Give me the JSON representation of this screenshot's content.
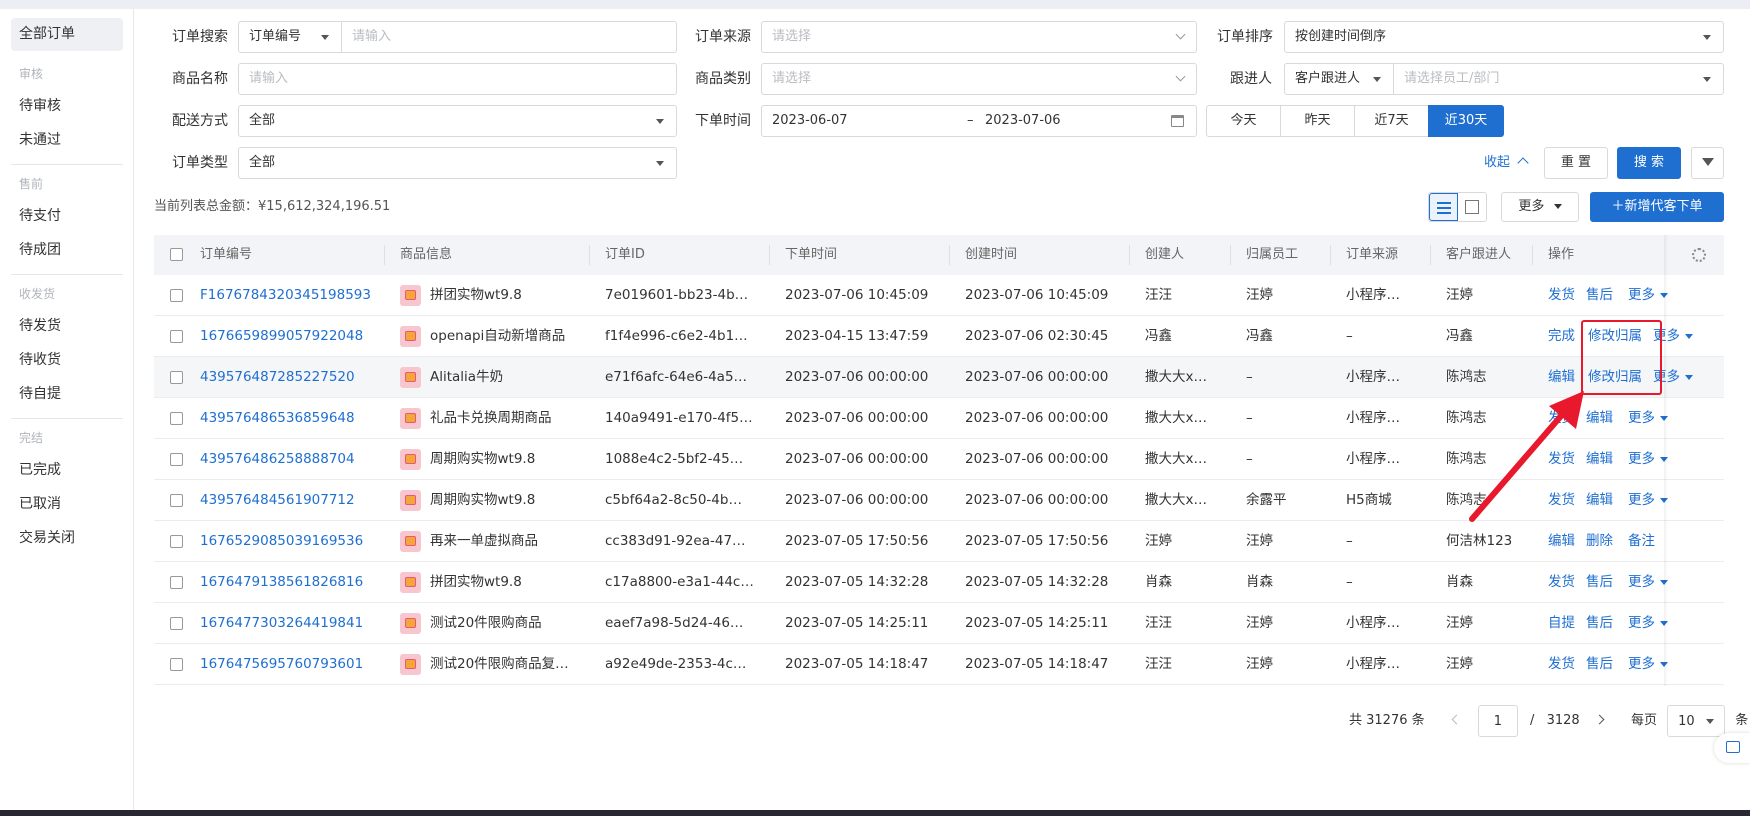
{
  "sidebar": {
    "active": "全部订单",
    "groups": [
      {
        "title": "审核",
        "items": [
          "待审核",
          "未通过"
        ]
      },
      {
        "title": "售前",
        "items": [
          "待支付",
          "待成团"
        ]
      },
      {
        "title": "收发货",
        "items": [
          "待发货",
          "待收货",
          "待自提"
        ]
      },
      {
        "title": "完结",
        "items": [
          "已完成",
          "已取消",
          "交易关闭"
        ]
      }
    ]
  },
  "filters": {
    "order_search_label": "订单搜索",
    "order_search_type": "订单编号",
    "order_search_placeholder": "请输入",
    "order_source_label": "订单来源",
    "order_source_placeholder": "请选择",
    "order_sort_label": "订单排序",
    "order_sort_value": "按创建时间倒序",
    "product_name_label": "商品名称",
    "product_name_placeholder": "请输入",
    "product_category_label": "商品类别",
    "product_category_placeholder": "请选择",
    "follower_label": "跟进人",
    "follower_type": "客户跟进人",
    "follower_placeholder": "请选择员工/部门",
    "delivery_label": "配送方式",
    "delivery_value": "全部",
    "order_time_label": "下单时间",
    "date_start": "2023-06-07",
    "date_sep": "–",
    "date_end": "2023-07-06",
    "quick_ranges": [
      "今天",
      "昨天",
      "近7天",
      "近30天"
    ],
    "order_type_label": "订单类型",
    "order_type_value": "全部",
    "collapse": "收起",
    "reset": "重 置",
    "search": "搜 索"
  },
  "summary": "当前列表总金额：¥15,612,324,196.51",
  "toolbar": {
    "more": "更多",
    "add_order": "新增代客下单"
  },
  "table": {
    "headers": [
      "订单编号",
      "商品信息",
      "订单ID",
      "下单时间",
      "创建时间",
      "创建人",
      "归属员工",
      "订单来源",
      "客户跟进人",
      "操作"
    ],
    "rows": [
      {
        "no": "F1676784320345198593",
        "product": "拼团实物wt9.8",
        "id": "7e019601-bb23-4b…",
        "order_time": "2023-07-06 10:45:09",
        "create_time": "2023-07-06 10:45:09",
        "creator": "汪汪",
        "staff": "汪婷",
        "source": "小程序…",
        "follower": "汪婷",
        "ops": [
          "发货",
          "售后",
          "更多"
        ]
      },
      {
        "no": "1676659899057922048",
        "product": "openapi自动新增商品",
        "id": "f1f4e996-c6e2-4b1…",
        "order_time": "2023-04-15 13:47:59",
        "create_time": "2023-07-06 02:30:45",
        "creator": "冯鑫",
        "staff": "冯鑫",
        "source": "–",
        "follower": "冯鑫",
        "ops": [
          "完成",
          "修改归属",
          "更多"
        ]
      },
      {
        "no": "439576487285227520",
        "product": "Alitalia牛奶",
        "id": "e71f6afc-64e6-4a5…",
        "order_time": "2023-07-06 00:00:00",
        "create_time": "2023-07-06 00:00:00",
        "creator": "撒大大x…",
        "staff": "–",
        "source": "小程序…",
        "follower": "陈鸿志",
        "ops": [
          "编辑",
          "修改归属",
          "更多"
        ]
      },
      {
        "no": "439576486536859648",
        "product": "礼品卡兑换周期商品",
        "id": "140a9491-e170-4f5…",
        "order_time": "2023-07-06 00:00:00",
        "create_time": "2023-07-06 00:00:00",
        "creator": "撒大大x…",
        "staff": "–",
        "source": "小程序…",
        "follower": "陈鸿志",
        "ops": [
          "发货",
          "编辑",
          "更多"
        ]
      },
      {
        "no": "439576486258888704",
        "product": "周期购实物wt9.8",
        "id": "1088e4c2-5bf2-45…",
        "order_time": "2023-07-06 00:00:00",
        "create_time": "2023-07-06 00:00:00",
        "creator": "撒大大x…",
        "staff": "–",
        "source": "小程序…",
        "follower": "陈鸿志",
        "ops": [
          "发货",
          "编辑",
          "更多"
        ]
      },
      {
        "no": "439576484561907712",
        "product": "周期购实物wt9.8",
        "id": "c5bf64a2-8c50-4b…",
        "order_time": "2023-07-06 00:00:00",
        "create_time": "2023-07-06 00:00:00",
        "creator": "撒大大x…",
        "staff": "余露平",
        "source": "H5商城",
        "follower": "陈鸿志",
        "ops": [
          "发货",
          "编辑",
          "更多"
        ]
      },
      {
        "no": "1676529085039169536",
        "product": "再来一单虚拟商品",
        "id": "cc383d91-92ea-47…",
        "order_time": "2023-07-05 17:50:56",
        "create_time": "2023-07-05 17:50:56",
        "creator": "汪婷",
        "staff": "汪婷",
        "source": "–",
        "follower": "何洁林123",
        "ops": [
          "编辑",
          "删除",
          "备注"
        ]
      },
      {
        "no": "1676479138561826816",
        "product": "拼团实物wt9.8",
        "id": "c17a8800-e3a1-44c…",
        "order_time": "2023-07-05 14:32:28",
        "create_time": "2023-07-05 14:32:28",
        "creator": "肖森",
        "staff": "肖森",
        "source": "–",
        "follower": "肖森",
        "ops": [
          "发货",
          "售后",
          "更多"
        ]
      },
      {
        "no": "1676477303264419841",
        "product": "测试20件限购商品",
        "id": "eaef7a98-5d24-46…",
        "order_time": "2023-07-05 14:25:11",
        "create_time": "2023-07-05 14:25:11",
        "creator": "汪汪",
        "staff": "汪婷",
        "source": "小程序…",
        "follower": "汪婷",
        "ops": [
          "自提",
          "售后",
          "更多"
        ]
      },
      {
        "no": "1676475695760793601",
        "product": "测试20件限购商品复…",
        "id": "a92e49de-2353-4c…",
        "order_time": "2023-07-05 14:18:47",
        "create_time": "2023-07-05 14:18:47",
        "creator": "汪汪",
        "staff": "汪婷",
        "source": "小程序…",
        "follower": "汪婷",
        "ops": [
          "发货",
          "售后",
          "更多"
        ]
      }
    ]
  },
  "pagination": {
    "total": "共 31276 条",
    "current": "1",
    "sep": "/",
    "pages": "3128",
    "per_page_label": "每页",
    "per_page": "10",
    "unit": "条"
  },
  "colors": {
    "primary": "#1f6fd1",
    "highlight": "#e8192c"
  }
}
